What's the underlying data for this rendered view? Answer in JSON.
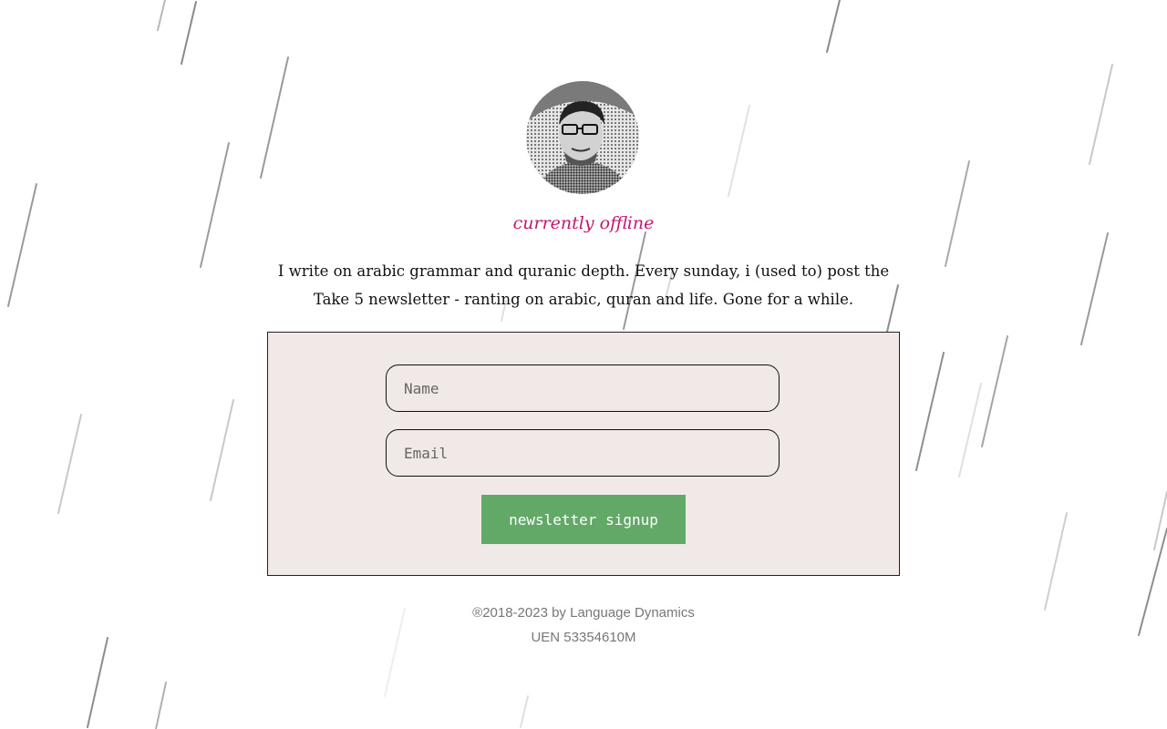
{
  "profile": {
    "avatar_alt": "author portrait",
    "status": "currently offline",
    "bio": "I write on arabic grammar and quranic depth. Every sunday, i (used to) post the Take 5 newsletter - ranting on arabic, quran and life. Gone for a while."
  },
  "signup": {
    "name_placeholder": "Name",
    "email_placeholder": "Email",
    "button_label": "newsletter signup"
  },
  "footer": {
    "copyright": "®2018-2023 by Language Dynamics",
    "uen": "UEN 53354610M"
  },
  "colors": {
    "status": "#c2186f",
    "button": "#62a867",
    "box_background": "#f1e9e7"
  }
}
